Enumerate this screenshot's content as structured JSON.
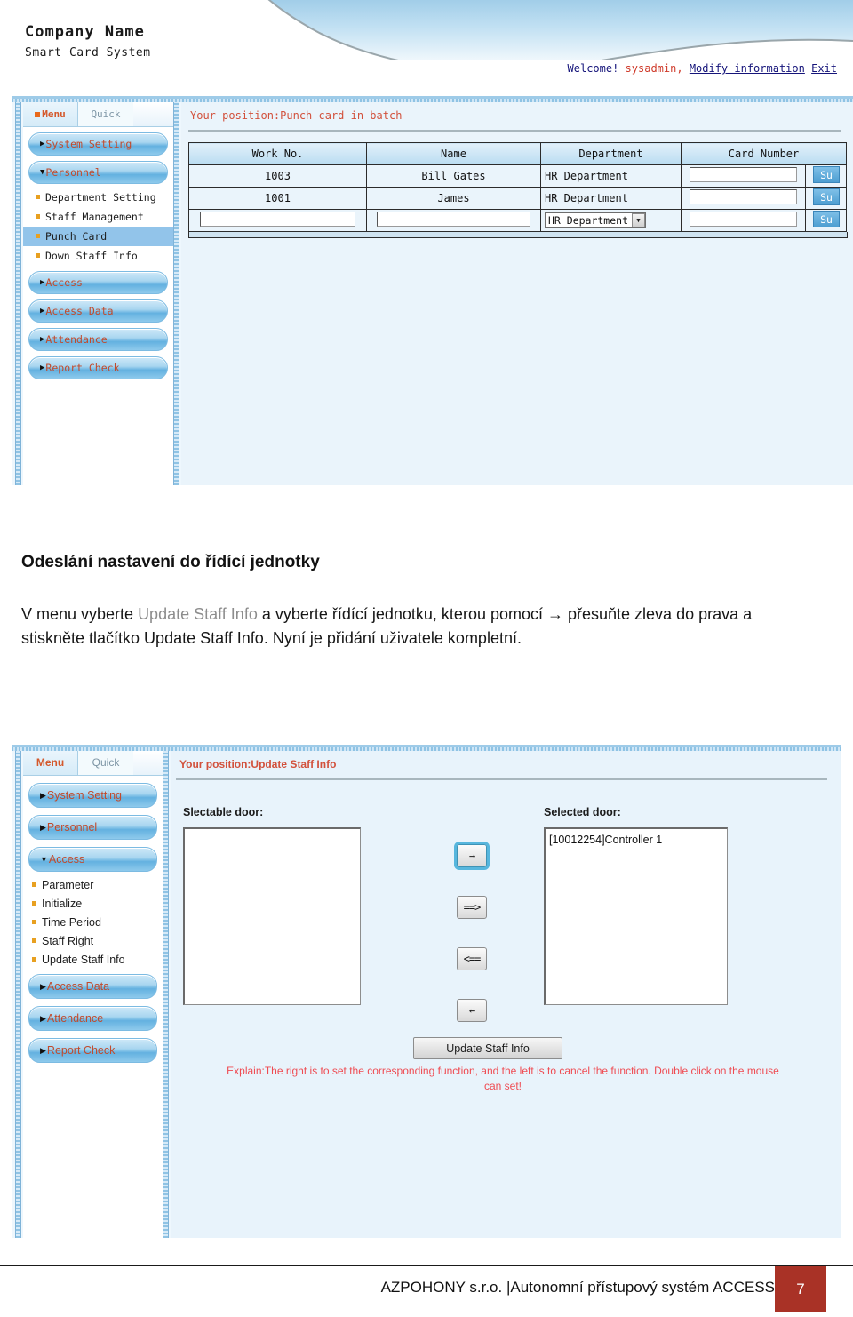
{
  "page": {
    "heading": "Odeslání nastavení do řídící jednotky",
    "body_pre": "V menu vyberte ",
    "body_dim": "Update Staff Info",
    "body_post": " a vyberte řídící jednotku, kterou pomocí → přesuňte zleva do prava a stiskněte tlačítko Update Staff Info. Nyní je přidání uživatele kompletní."
  },
  "footer": {
    "text": "AZPOHONY s.r.o. |Autonomní přístupový systém ACCESS",
    "page_number": "7",
    "accent_color": "#a93226"
  },
  "banner": {
    "company": "Company Name",
    "subtitle": "Smart Card System",
    "welcome_prefix": "Welcome!",
    "user": "sysadmin,",
    "modify_link": "Modify information",
    "exit_link": "Exit"
  },
  "shot1": {
    "tabs": [
      {
        "label": "Menu",
        "active": true
      },
      {
        "label": "Quick",
        "active": false
      }
    ],
    "sidebar": [
      {
        "type": "group",
        "label": "System Setting",
        "caret": "▶"
      },
      {
        "type": "group",
        "label": "Personnel",
        "caret": "▼"
      },
      {
        "type": "leaf",
        "label": "Department Setting",
        "selected": false
      },
      {
        "type": "leaf",
        "label": "Staff Management",
        "selected": false
      },
      {
        "type": "leaf",
        "label": "Punch Card",
        "selected": true
      },
      {
        "type": "leaf",
        "label": "Down Staff Info",
        "selected": false
      },
      {
        "type": "group",
        "label": "Access",
        "caret": "▶"
      },
      {
        "type": "group",
        "label": "Access Data",
        "caret": "▶"
      },
      {
        "type": "group",
        "label": "Attendance",
        "caret": "▶"
      },
      {
        "type": "group",
        "label": "Report Check",
        "caret": "▶"
      }
    ],
    "position": "Your position:Punch card in batch",
    "table": {
      "headers": [
        "Work No.",
        "Name",
        "Department",
        "Card Number",
        ""
      ],
      "rows": [
        {
          "work_no": "1003",
          "name": "Bill Gates",
          "department": "HR Department",
          "card_number": "",
          "action": "Su"
        },
        {
          "work_no": "1001",
          "name": "James",
          "department": "HR Department",
          "card_number": "",
          "action": "Su"
        }
      ],
      "new_row": {
        "work_no": "",
        "work_no_placeholder": "",
        "name": "",
        "name_placeholder": "",
        "department_selected": "HR Department",
        "card_number": "",
        "action": "Su"
      }
    }
  },
  "shot2": {
    "tabs": [
      {
        "label": "Menu",
        "active": true
      },
      {
        "label": "Quick",
        "active": false
      }
    ],
    "sidebar": [
      {
        "type": "group",
        "label": "System Setting",
        "caret": "▶"
      },
      {
        "type": "group",
        "label": "Personnel",
        "caret": "▶"
      },
      {
        "type": "group",
        "label": "Access",
        "caret": "▼"
      },
      {
        "type": "leaf",
        "label": "Parameter",
        "selected": false
      },
      {
        "type": "leaf",
        "label": "Initialize",
        "selected": false
      },
      {
        "type": "leaf",
        "label": "Time Period",
        "selected": false
      },
      {
        "type": "leaf",
        "label": "Staff Right",
        "selected": false
      },
      {
        "type": "leaf",
        "label": "Update Staff Info",
        "selected": false
      },
      {
        "type": "group",
        "label": "Access Data",
        "caret": "▶"
      },
      {
        "type": "group",
        "label": "Attendance",
        "caret": "▶"
      },
      {
        "type": "group",
        "label": "Report Check",
        "caret": "▶"
      }
    ],
    "position": "Your position:Update Staff Info",
    "selectable_label": "Slectable door:",
    "selected_label": "Selected door:",
    "selectable_items": [],
    "selected_items": [
      "[10012254]Controller 1"
    ],
    "transfer_buttons": [
      {
        "label": "→",
        "name": "move-right-single",
        "focused": true
      },
      {
        "label": "==>",
        "name": "move-right-all",
        "focused": false
      },
      {
        "label": "<==",
        "name": "move-left-all",
        "focused": false
      },
      {
        "label": "←",
        "name": "move-left-single",
        "focused": false
      }
    ],
    "update_button": "Update Staff Info",
    "explain_line1": "Explain:The right is to set the corresponding function, and the left is to cancel the function. Double click on the mouse",
    "explain_line2": "can set!"
  }
}
